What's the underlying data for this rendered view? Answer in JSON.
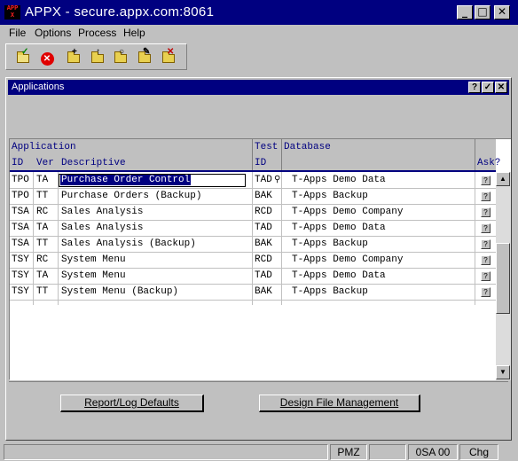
{
  "window": {
    "title": "APPX - secure.appx.com:8061",
    "icon_text": "APPX",
    "buttons": [
      "minimize",
      "maximize",
      "close"
    ]
  },
  "menu": [
    "File",
    "Options",
    "Process",
    "Help"
  ],
  "toolbar": {
    "buttons": [
      "ok-check",
      "cancel",
      "folder-new",
      "folder-open",
      "folder-search",
      "folder-edit",
      "folder-delete"
    ]
  },
  "child": {
    "title": "Applications",
    "buttons": [
      "?",
      "✓",
      "✕"
    ]
  },
  "grid": {
    "headers": {
      "group_application": "Application",
      "id": "ID",
      "ver": "Ver",
      "descriptive": "Descriptive",
      "test_line1": "Test",
      "test_line2": "ID",
      "database": "Database",
      "ask": "Ask?"
    },
    "rows": [
      {
        "id": "TPO",
        "ver": "TA",
        "desc": "Purchase Order Control",
        "test": "TAD",
        "db": "T-Apps Demo Data",
        "ask": "?"
      },
      {
        "id": "TPO",
        "ver": "TT",
        "desc": "Purchase Orders (Backup)",
        "test": "BAK",
        "db": "T-Apps Backup",
        "ask": "?"
      },
      {
        "id": "TSA",
        "ver": "RC",
        "desc": "Sales Analysis",
        "test": "RCD",
        "db": "T-Apps Demo Company",
        "ask": "?"
      },
      {
        "id": "TSA",
        "ver": "TA",
        "desc": "Sales Analysis",
        "test": "TAD",
        "db": "T-Apps Demo Data",
        "ask": "?"
      },
      {
        "id": "TSA",
        "ver": "TT",
        "desc": "Sales Analysis (Backup)",
        "test": "BAK",
        "db": "T-Apps Backup",
        "ask": "?"
      },
      {
        "id": "TSY",
        "ver": "RC",
        "desc": "System Menu",
        "test": "RCD",
        "db": "T-Apps Demo Company",
        "ask": "?"
      },
      {
        "id": "TSY",
        "ver": "TA",
        "desc": "System Menu",
        "test": "TAD",
        "db": "T-Apps Demo Data",
        "ask": "?"
      },
      {
        "id": "TSY",
        "ver": "TT",
        "desc": "System Menu (Backup)",
        "test": "BAK",
        "db": "T-Apps Backup",
        "ask": "?"
      }
    ]
  },
  "buttons": {
    "report_log": "Report/Log Defaults",
    "design_file": "Design File Management"
  },
  "status": {
    "p1": "",
    "p2": "PMZ",
    "p3": "",
    "p4": "0SA 00",
    "p5": "Chg"
  },
  "colors": {
    "title_bar": "#000080",
    "face": "#c0c0c0",
    "header_text": "#000080"
  }
}
